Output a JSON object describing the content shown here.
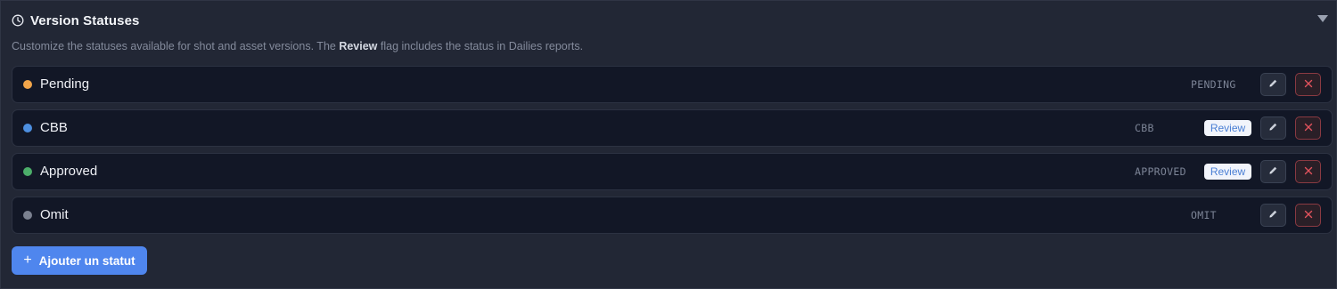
{
  "section": {
    "title": "Version Statuses",
    "icon": "clock-icon",
    "collapse_icon": "triangle-down-icon"
  },
  "description": {
    "before": "Customize the statuses available for shot and asset versions. The ",
    "bold": "Review",
    "after": " flag includes the status in Dailies reports."
  },
  "statuses": [
    {
      "name": "Pending",
      "code": "PENDING",
      "color": "#f2a54a",
      "review": ""
    },
    {
      "name": "CBB",
      "code": "CBB",
      "color": "#4d8fe0",
      "review": "Review"
    },
    {
      "name": "Approved",
      "code": "APPROVED",
      "color": "#4cae6a",
      "review": "Review"
    },
    {
      "name": "Omit",
      "code": "OMIT",
      "color": "#7b8190",
      "review": ""
    }
  ],
  "row_icons": {
    "edit": "pencil-icon",
    "delete": "close-icon"
  },
  "add_button": {
    "icon": "plus-icon",
    "label": "Ajouter un statut"
  },
  "colors": {
    "accent": "#4f86ee",
    "danger": "#e0525c",
    "background": "#222735",
    "row_background": "#121726"
  }
}
